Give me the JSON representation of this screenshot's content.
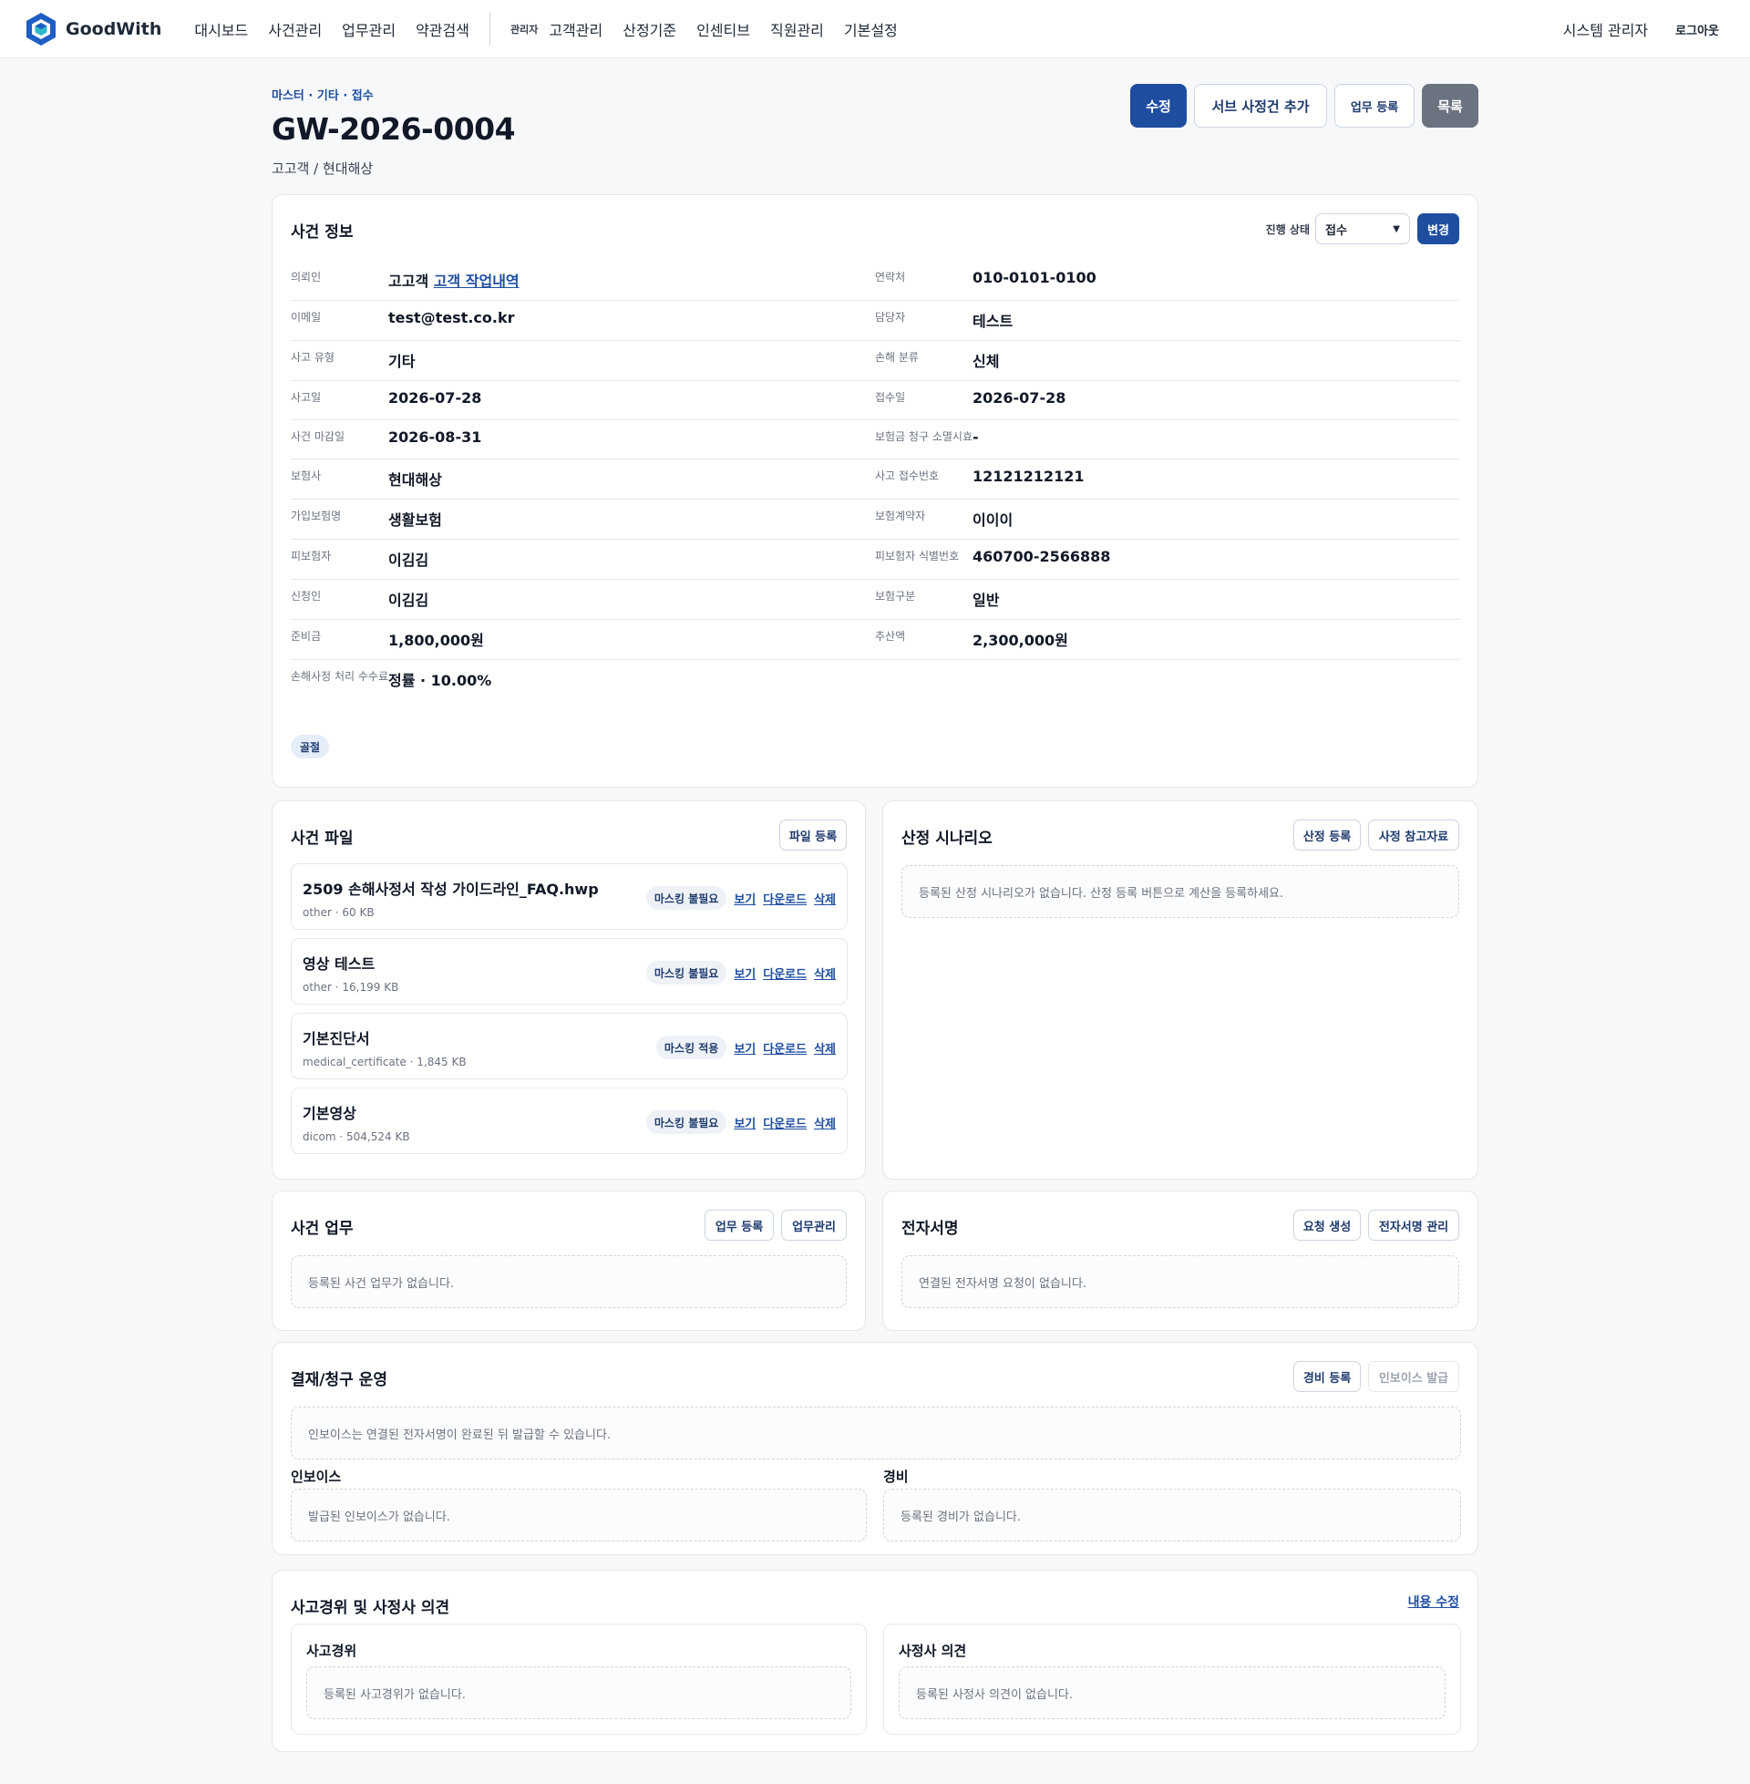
{
  "nav": {
    "brand": "GoodWith",
    "menu": [
      "대시보드",
      "사건관리",
      "업무관리",
      "약관검색"
    ],
    "admin_tag": "관리자",
    "admin_menu": [
      "고객관리",
      "산정기준",
      "인센티브",
      "직원관리",
      "기본설정"
    ],
    "user": "시스템 관리자",
    "logout": "로그아웃"
  },
  "header": {
    "breadcrumb": "마스터 · 기타 · 접수",
    "case_no": "GW-2026-0004",
    "subtitle": "고고객 / 현대해상",
    "actions": [
      "수정",
      "서브 사정건 추가",
      "업무 등록",
      "목록"
    ]
  },
  "case_info": {
    "title": "사건 정보",
    "status_label": "진행 상태",
    "status_value": "접수",
    "change_btn": "변경",
    "rows": [
      {
        "label": "의뢰인",
        "value": "고고객",
        "link": "고객 작업내역"
      },
      {
        "label": "연락처",
        "value": "010-0101-0100"
      },
      {
        "label": "이메일",
        "value": "test@test.co.kr"
      },
      {
        "label": "담당자",
        "value": "테스트"
      },
      {
        "label": "사고 유형",
        "value": "기타"
      },
      {
        "label": "손해 분류",
        "value": "신체"
      },
      {
        "label": "사고일",
        "value": "2026-07-28"
      },
      {
        "label": "접수일",
        "value": "2026-07-28"
      },
      {
        "label": "사건 마감일",
        "value": "2026-08-31"
      },
      {
        "label": "보험금 청구 소멸시효",
        "value": "-"
      },
      {
        "label": "보험사",
        "value": "현대해상"
      },
      {
        "label": "사고 접수번호",
        "value": "12121212121"
      },
      {
        "label": "가입보험명",
        "value": "생활보험"
      },
      {
        "label": "보험계약자",
        "value": "이이이"
      },
      {
        "label": "피보험자",
        "value": "이김김"
      },
      {
        "label": "피보험자 식별번호",
        "value": "460700-2566888"
      },
      {
        "label": "신청인",
        "value": "이김김"
      },
      {
        "label": "보험구분",
        "value": "일반"
      },
      {
        "label": "준비금",
        "value": "1,800,000원"
      },
      {
        "label": "추산액",
        "value": "2,300,000원"
      },
      {
        "label": "손해사정 처리 수수료",
        "value": "정률 · 10.00%"
      }
    ],
    "tag": "골절"
  },
  "files": {
    "title": "사건 파일",
    "register_btn": "파일 등록",
    "view": "보기",
    "download": "다운로드",
    "delete": "삭제",
    "items": [
      {
        "name": "2509 손해사정서 작성 가이드라인_FAQ.hwp",
        "meta": "other · 60 KB",
        "mask": "마스킹 불필요"
      },
      {
        "name": "영상 테스트",
        "meta": "other · 16,199 KB",
        "mask": "마스킹 불필요"
      },
      {
        "name": "기본진단서",
        "meta": "medical_certificate · 1,845 KB",
        "mask": "마스킹 적용"
      },
      {
        "name": "기본영상",
        "meta": "dicom · 504,524 KB",
        "mask": "마스킹 불필요"
      }
    ]
  },
  "scenario": {
    "title": "산정 시나리오",
    "btn_register": "산정 등록",
    "btn_ref": "사정 참고자료",
    "empty": "등록된 산정 시나리오가 없습니다. 산정 등록 버튼으로 계산을 등록하세요."
  },
  "tasks": {
    "title": "사건 업무",
    "btn_register": "업무 등록",
    "btn_manage": "업무관리",
    "empty": "등록된 사건 업무가 없습니다."
  },
  "esign": {
    "title": "전자서명",
    "btn_create": "요청 생성",
    "btn_manage": "전자서명 관리",
    "empty": "연결된 전자서명 요청이 없습니다."
  },
  "billing": {
    "title": "결재/청구 운영",
    "btn_expense": "경비 등록",
    "btn_invoice": "인보이스 발급",
    "notice": "인보이스는 연결된 전자서명이 완료된 뒤 발급할 수 있습니다.",
    "invoice_title": "인보이스",
    "invoice_empty": "발급된 인보이스가 없습니다.",
    "expense_title": "경비",
    "expense_empty": "등록된 경비가 없습니다."
  },
  "opinion": {
    "title": "사고경위 및 사정사 의견",
    "edit": "내용 수정",
    "accident_title": "사고경위",
    "accident_empty": "등록된 사고경위가 없습니다.",
    "adjuster_title": "사정사 의견",
    "adjuster_empty": "등록된 사정사 의견이 없습니다."
  },
  "colors": {
    "primary": "#1f4ea1",
    "gray_btn": "#6b7280",
    "link": "#1e4ea1"
  }
}
